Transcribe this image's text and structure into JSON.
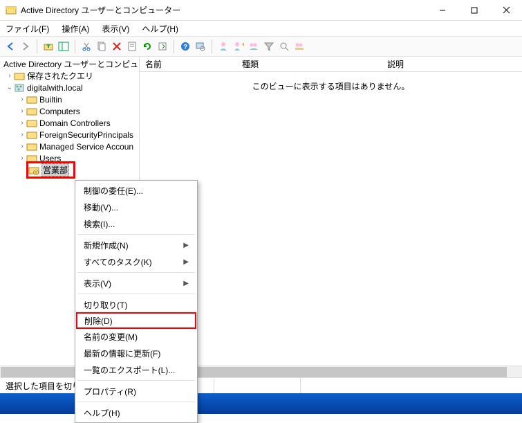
{
  "window": {
    "title": "Active Directory ユーザーとコンピューター"
  },
  "menubar": {
    "file": "ファイル(F)",
    "action": "操作(A)",
    "view": "表示(V)",
    "help": "ヘルプ(H)"
  },
  "tree": {
    "root": "Active Directory ユーザーとコンピュー",
    "saved_queries": "保存されたクエリ",
    "domain": "digitalwith.local",
    "nodes": {
      "builtin": "Builtin",
      "computers": "Computers",
      "domain_controllers": "Domain Controllers",
      "fsp": "ForeignSecurityPrincipals",
      "msa": "Managed Service Accoun",
      "users": "Users",
      "sales": "営業部"
    }
  },
  "list": {
    "col_name": "名前",
    "col_type": "種類",
    "col_desc": "説明",
    "empty": "このビューに表示する項目はありません。"
  },
  "status": {
    "text": "選択した項目を切り取"
  },
  "context_menu": {
    "delegate": "制御の委任(E)...",
    "move": "移動(V)...",
    "find": "検索(I)...",
    "new": "新規作成(N)",
    "all_tasks": "すべてのタスク(K)",
    "view": "表示(V)",
    "cut": "切り取り(T)",
    "delete": "削除(D)",
    "rename": "名前の変更(M)",
    "refresh": "最新の情報に更新(F)",
    "export_list": "一覧のエクスポート(L)...",
    "properties": "プロパティ(R)",
    "help": "ヘルプ(H)"
  }
}
